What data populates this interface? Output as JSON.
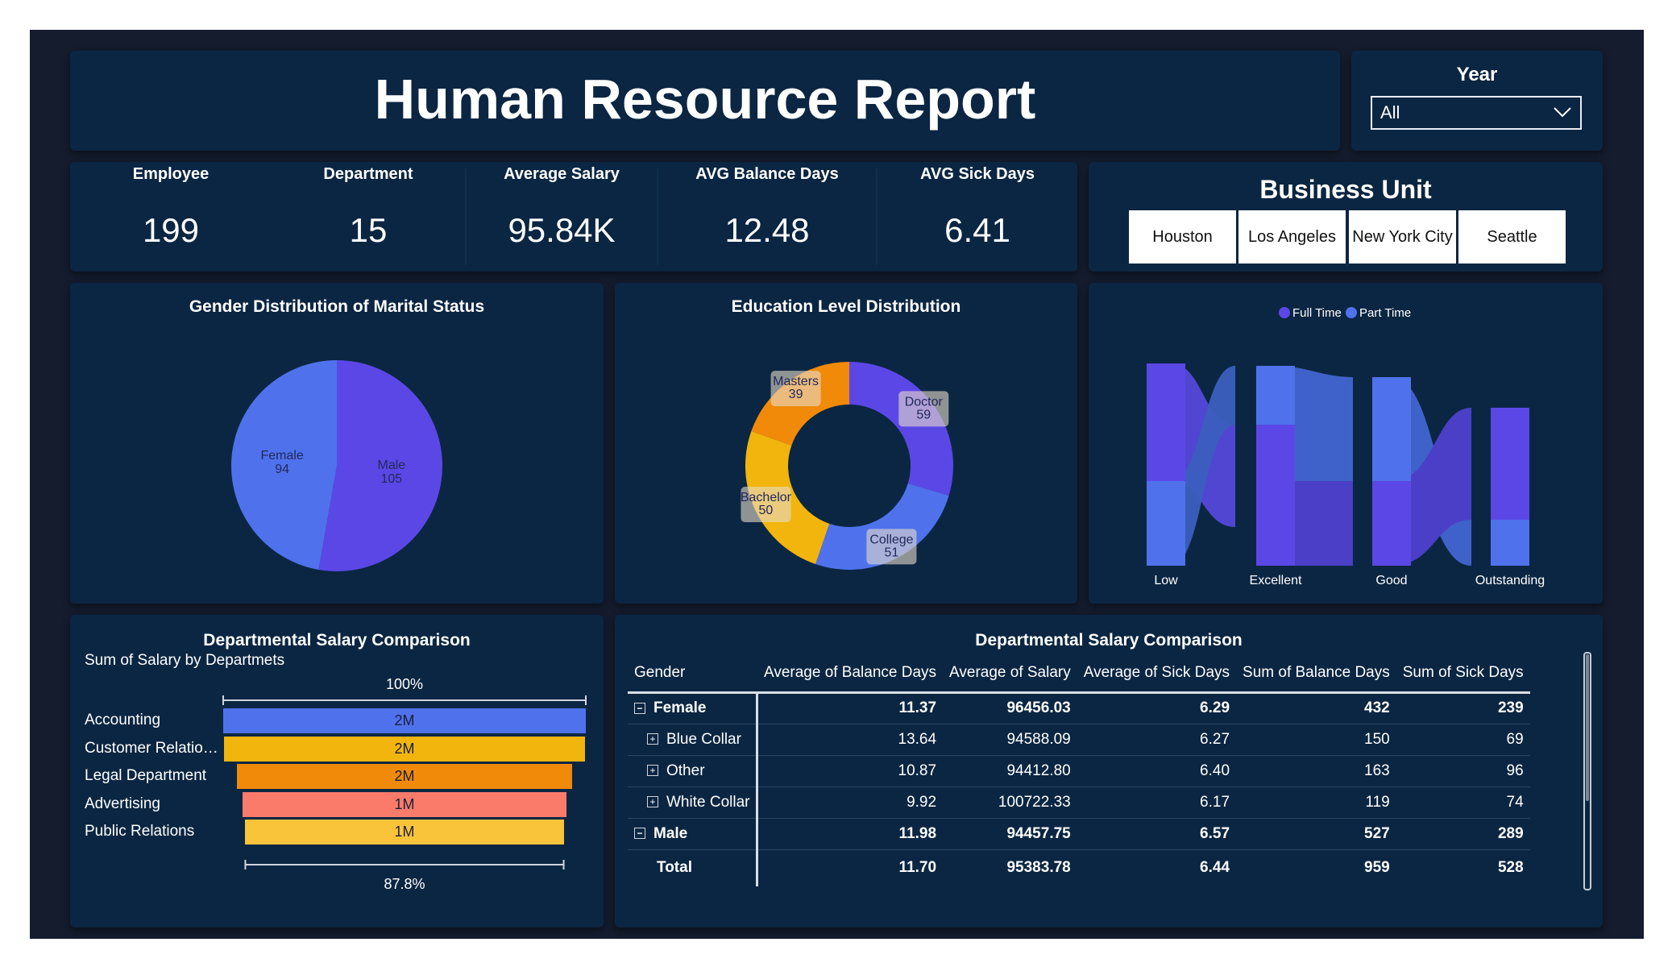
{
  "header": {
    "title": "Human Resource Report"
  },
  "year_filter": {
    "label": "Year",
    "value": "All"
  },
  "kpis": [
    {
      "label": "Employee",
      "value": "199"
    },
    {
      "label": "Department",
      "value": "15"
    },
    {
      "label": "Average Salary",
      "value": "95.84K"
    },
    {
      "label": "AVG Balance Days",
      "value": "12.48"
    },
    {
      "label": "AVG Sick Days",
      "value": "6.41"
    }
  ],
  "business_unit": {
    "title": "Business Unit",
    "options": [
      "Houston",
      "Los Angeles",
      "New York City",
      "Seattle"
    ]
  },
  "gender_pie": {
    "title": "Gender Distribution of Marital Status",
    "chart_data": {
      "type": "pie",
      "categories": [
        "Male",
        "Female"
      ],
      "values": [
        105,
        94
      ],
      "colors": [
        "#5b47e6",
        "#4f72ec"
      ]
    }
  },
  "education_donut": {
    "title": "Education Level Distribution",
    "chart_data": {
      "type": "pie",
      "donut": true,
      "categories": [
        "Doctor",
        "College",
        "Bachelor",
        "Masters"
      ],
      "values": [
        59,
        51,
        50,
        39
      ],
      "colors": [
        "#5b47e6",
        "#4f72ec",
        "#f1b50e",
        "#f18a09"
      ]
    }
  },
  "ribbon_chart": {
    "legend": [
      "Full Time",
      "Part Time"
    ],
    "colors": [
      "#5b47e6",
      "#4f72ec"
    ],
    "categories": [
      "Low",
      "Excellent",
      "Good",
      "Outstanding"
    ]
  },
  "funnel": {
    "title": "Departmental Salary Comparison",
    "subtitle": "Sum of Salary by Departmets",
    "top_pct": "100%",
    "bottom_pct": "87.8%",
    "chart_data": {
      "type": "bar",
      "orientation": "funnel",
      "categories": [
        "Accounting",
        "Customer Relatio…",
        "Legal Department",
        "Advertising",
        "Public Relations"
      ],
      "value_labels": [
        "2M",
        "2M",
        "2M",
        "1M",
        "1M"
      ],
      "relative": [
        1.0,
        0.995,
        0.925,
        0.892,
        0.878
      ],
      "colors": [
        "#4f72ec",
        "#f1b50e",
        "#f18a09",
        "#fb7b6b",
        "#f9c43a"
      ]
    }
  },
  "matrix": {
    "title": "Departmental Salary Comparison",
    "columns": [
      "Gender",
      "Average of Balance Days",
      "Average of Salary",
      "Average of Sick Days",
      "Sum of Balance Days",
      "Sum of Sick Days"
    ],
    "rows": [
      {
        "label": "Female",
        "toggle": "−",
        "level": 0,
        "bold": true,
        "cells": [
          "11.37",
          "96456.03",
          "6.29",
          "432",
          "239"
        ]
      },
      {
        "label": "Blue Collar",
        "toggle": "+",
        "level": 1,
        "bold": false,
        "cells": [
          "13.64",
          "94588.09",
          "6.27",
          "150",
          "69"
        ]
      },
      {
        "label": "Other",
        "toggle": "+",
        "level": 1,
        "bold": false,
        "cells": [
          "10.87",
          "94412.80",
          "6.40",
          "163",
          "96"
        ]
      },
      {
        "label": "White Collar",
        "toggle": "+",
        "level": 1,
        "bold": false,
        "cells": [
          "9.92",
          "100722.33",
          "6.17",
          "119",
          "74"
        ]
      },
      {
        "label": "Male",
        "toggle": "−",
        "level": 0,
        "bold": true,
        "cells": [
          "11.98",
          "94457.75",
          "6.57",
          "527",
          "289"
        ]
      }
    ],
    "total": {
      "label": "Total",
      "cells": [
        "11.70",
        "95383.78",
        "6.44",
        "959",
        "528"
      ]
    }
  }
}
